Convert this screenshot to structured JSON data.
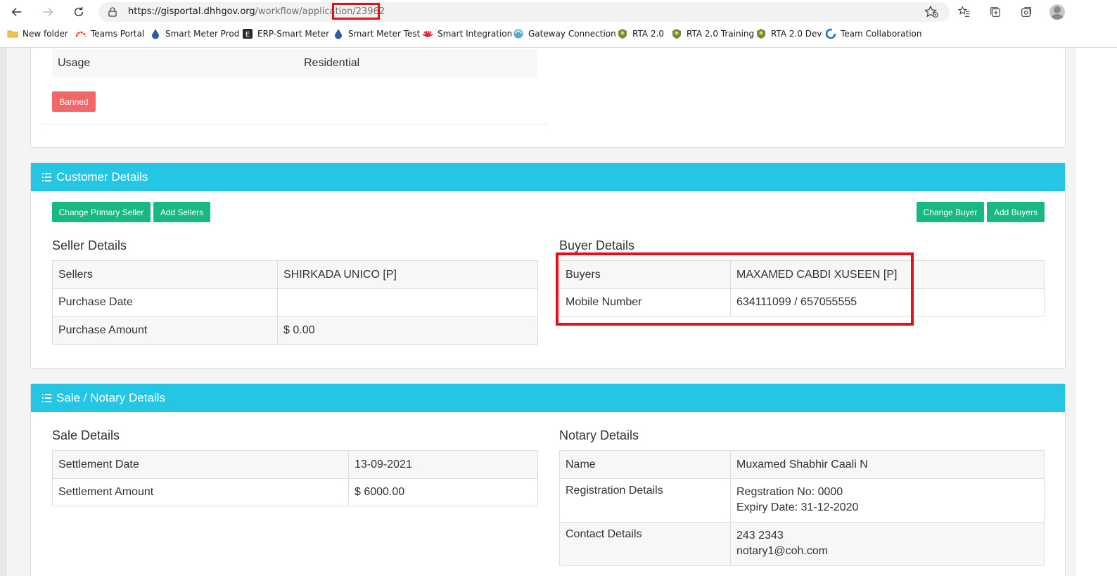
{
  "browser": {
    "url_host": "https://gisportal.dhhgov.org",
    "url_path": "/workflow/applicatio",
    "url_tail": "n/23962",
    "bookmarks": [
      {
        "label": "New folder",
        "icon": "folder-icon"
      },
      {
        "label": "Teams Portal",
        "icon": "teams-portal-icon"
      },
      {
        "label": "Smart Meter Prod",
        "icon": "water-drop-icon"
      },
      {
        "label": "ERP-Smart Meter",
        "icon": "erp-icon"
      },
      {
        "label": "Smart Meter Test",
        "icon": "water-drop-icon"
      },
      {
        "label": "Smart Integration",
        "icon": "huawei-icon"
      },
      {
        "label": "Gateway Connection",
        "icon": "gateway-icon"
      },
      {
        "label": "RTA 2.0",
        "icon": "emblem-icon"
      },
      {
        "label": "RTA 2.0 Training",
        "icon": "emblem-icon"
      },
      {
        "label": "RTA 2.0 Dev",
        "icon": "emblem-icon"
      },
      {
        "label": "Team Collaboration",
        "icon": "collab-icon"
      }
    ]
  },
  "property_card": {
    "usage_label": "Usage",
    "usage_value": "Residential",
    "banned_label": "Banned"
  },
  "customer": {
    "title": "Customer Details",
    "change_primary_seller": "Change Primary Seller",
    "add_sellers": "Add Sellers",
    "change_buyer": "Change Buyer",
    "add_buyers": "Add Buyers",
    "seller_title": "Seller Details",
    "seller_rows": [
      {
        "label": "Sellers",
        "value": "SHIRKADA UNICO [P]"
      },
      {
        "label": "Purchase Date",
        "value": ""
      },
      {
        "label": "Purchase Amount",
        "value": "$ 0.00"
      }
    ],
    "buyer_title": "Buyer Details",
    "buyer_rows": [
      {
        "label": "Buyers",
        "value": "MAXAMED CABDI XUSEEN [P]"
      },
      {
        "label": "Mobile Number",
        "value": "634111099 / 657055555"
      }
    ]
  },
  "sale": {
    "title": "Sale / Notary Details",
    "sale_title": "Sale Details",
    "sale_rows": [
      {
        "label": "Settlement Date",
        "value": "13-09-2021"
      },
      {
        "label": "Settlement Amount",
        "value": "$ 6000.00"
      }
    ],
    "notary_title": "Notary Details",
    "notary_name_label": "Name",
    "notary_name_value": "Muxamed Shabhir Caali N",
    "notary_reg_label": "Registration Details",
    "notary_reg_line1": "Regstration No: 0000",
    "notary_reg_line2": "Expiry Date: 31-12-2020",
    "notary_contact_label": "Contact Details",
    "notary_contact_line1": "243 2343",
    "notary_contact_line2": "notary1@coh.com"
  },
  "colors": {
    "header_bg": "#24c6e3",
    "button_green": "#17b883",
    "button_red": "#f26767",
    "highlight_red": "#e3101c"
  }
}
